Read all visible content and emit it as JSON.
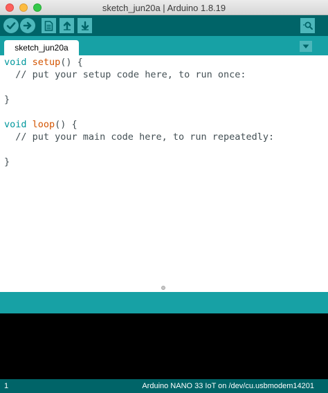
{
  "window": {
    "title": "sketch_jun20a | Arduino 1.8.19"
  },
  "toolbar": {
    "icons": [
      "checkmark-icon",
      "arrow-right-icon",
      "new-file-icon",
      "arrow-up-icon",
      "arrow-down-icon",
      "magnifier-icon"
    ]
  },
  "tabs": [
    {
      "label": "sketch_jun20a"
    }
  ],
  "editor": {
    "line1": {
      "kw": "void",
      "fn": "setup",
      "rest": "() {"
    },
    "line2": "  // put your setup code here, to run once:",
    "line4": "}",
    "line6": {
      "kw": "void",
      "fn": "loop",
      "rest": "() {"
    },
    "line7": "  // put your main code here, to run repeatedly:",
    "line9": "}"
  },
  "statusbar": {
    "line_number": "1",
    "board_info": "Arduino NANO 33 IoT on /dev/cu.usbmodem14201"
  },
  "colors": {
    "toolbar": "#006468",
    "tabbar": "#17a1a5",
    "button": "#4db7bb",
    "keyword": "#00979c",
    "function": "#d35400"
  }
}
